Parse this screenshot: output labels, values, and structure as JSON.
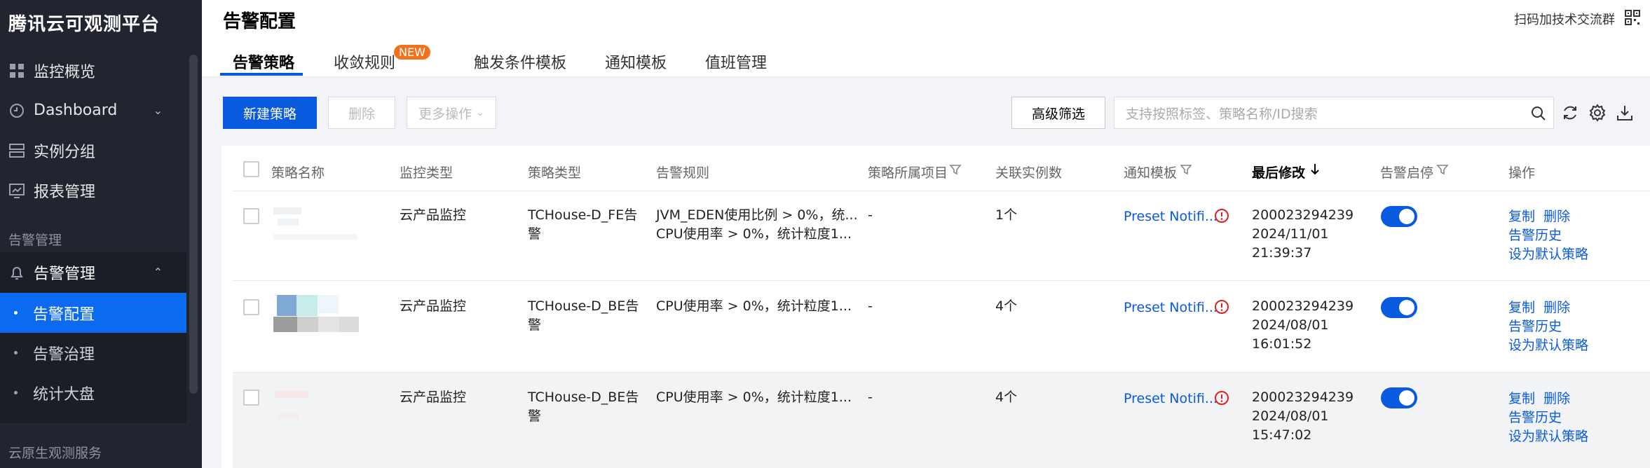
{
  "app": {
    "brand": "腾讯云可观测平台"
  },
  "sidebar": {
    "items": [
      {
        "label": "监控概览"
      },
      {
        "label": "Dashboard"
      },
      {
        "label": "实例分组"
      },
      {
        "label": "报表管理"
      }
    ],
    "group_label": "告警管理",
    "group": {
      "label": "告警管理"
    },
    "sub_items": [
      {
        "label": "告警配置"
      },
      {
        "label": "告警治理"
      },
      {
        "label": "统计大盘"
      }
    ],
    "bottom_group_label": "云原生观测服务"
  },
  "header": {
    "title": "告警配置",
    "qr_text": "扫码加技术交流群",
    "tabs": [
      {
        "label": "告警策略"
      },
      {
        "label": "收敛规则"
      },
      {
        "label": "触发条件模板"
      },
      {
        "label": "通知模板"
      },
      {
        "label": "值班管理"
      }
    ],
    "new_badge": "NEW"
  },
  "toolbar": {
    "new_policy": "新建策略",
    "delete": "删除",
    "more_ops": "更多操作",
    "advanced_filter": "高级筛选",
    "search_placeholder": "支持按照标签、策略名称/ID搜索"
  },
  "table": {
    "headers": {
      "name": "策略名称",
      "monitor_type": "监控类型",
      "policy_type": "策略类型",
      "rules": "告警规则",
      "project": "策略所属项目",
      "instances": "关联实例数",
      "notify": "通知模板",
      "modified": "最后修改",
      "toggle": "告警启停",
      "ops": "操作"
    },
    "rows": [
      {
        "monitor_type": "云产品监控",
        "policy_type_1": "TCHouse-D_FE告",
        "policy_type_2": "警",
        "rule_1": "JVM_EDEN使用比例 > 0%，统...",
        "rule_2": "CPU使用率 > 0%，统计粒度1...",
        "project": "-",
        "instances": "1个",
        "notify": "Preset Notifi...",
        "mod_user": "200023294239",
        "mod_date": "2024/11/01",
        "mod_time": "21:39:37",
        "op_copy": "复制",
        "op_delete": "删除",
        "op_history": "告警历史",
        "op_default": "设为默认策略"
      },
      {
        "monitor_type": "云产品监控",
        "policy_type_1": "TCHouse-D_BE告",
        "policy_type_2": "警",
        "rule_1": "CPU使用率 > 0%，统计粒度1...",
        "project": "-",
        "instances": "4个",
        "notify": "Preset Notifi...",
        "mod_user": "200023294239",
        "mod_date": "2024/08/01",
        "mod_time": "16:01:52",
        "op_copy": "复制",
        "op_delete": "删除",
        "op_history": "告警历史",
        "op_default": "设为默认策略"
      },
      {
        "monitor_type": "云产品监控",
        "policy_type_1": "TCHouse-D_BE告",
        "policy_type_2": "警",
        "rule_1": "CPU使用率 > 0%，统计粒度1...",
        "project": "-",
        "instances": "4个",
        "notify": "Preset Notifi...",
        "mod_user": "200023294239",
        "mod_date": "2024/08/01",
        "mod_time": "15:47:02",
        "op_copy": "复制",
        "op_delete": "删除",
        "op_history": "告警历史",
        "op_default": "设为默认策略"
      }
    ]
  },
  "colors": {
    "accent": "#0a5adf",
    "sidebar_bg": "#22252f",
    "active_nav": "#0a6bf0",
    "badge": "#f2711c",
    "warning": "#e02020"
  }
}
